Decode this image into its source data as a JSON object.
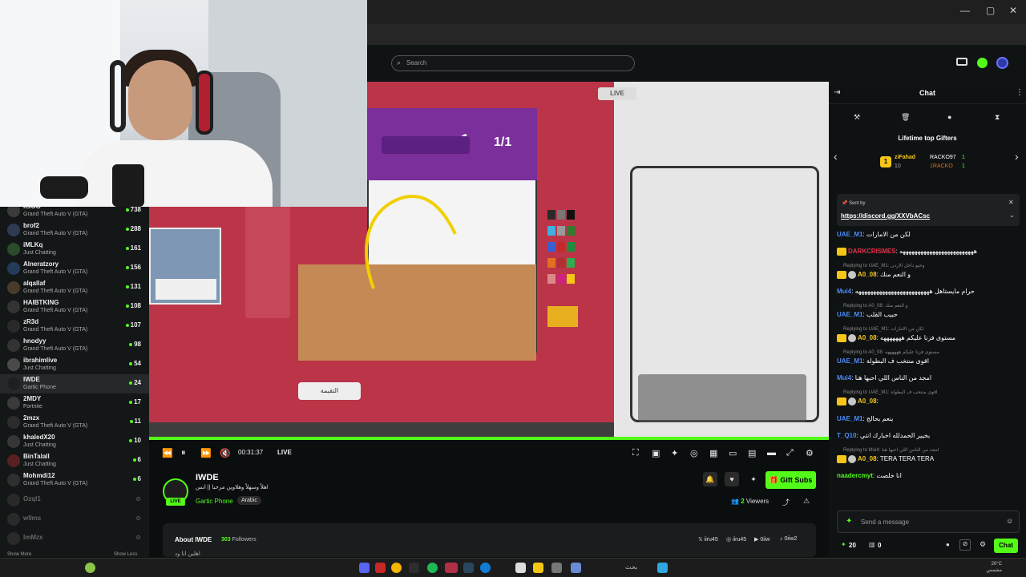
{
  "topbar": {
    "search_placeholder": "Search"
  },
  "sidebar": {
    "channels": [
      {
        "name": "itsOG",
        "game": "Grand Theft Auto V (GTA)",
        "viewers": "738"
      },
      {
        "name": "brof2",
        "game": "Grand Theft Auto V (GTA)",
        "viewers": "288"
      },
      {
        "name": "iMLKq",
        "game": "Just Chatting",
        "viewers": "161"
      },
      {
        "name": "Alneratzory",
        "game": "Grand Theft Auto V (GTA)",
        "viewers": "156"
      },
      {
        "name": "alqallaf",
        "game": "Grand Theft Auto V (GTA)",
        "viewers": "131"
      },
      {
        "name": "HAIBTKING",
        "game": "Grand Theft Auto V (GTA)",
        "viewers": "108"
      },
      {
        "name": "zR3d",
        "game": "Grand Theft Auto V (GTA)",
        "viewers": "107"
      },
      {
        "name": "hnodyy",
        "game": "Grand Theft Auto V (GTA)",
        "viewers": "98"
      },
      {
        "name": "ibrahimlive",
        "game": "Just Chatting",
        "viewers": "54"
      },
      {
        "name": "IWDE",
        "game": "Gartic Phone",
        "viewers": "24"
      },
      {
        "name": "2MDY",
        "game": "Fortnite",
        "viewers": "17"
      },
      {
        "name": "2mzx",
        "game": "Grand Theft Auto V (GTA)",
        "viewers": "11"
      },
      {
        "name": "khaledX20",
        "game": "Just Chatting",
        "viewers": "10"
      },
      {
        "name": "BinTalall",
        "game": "Just Chatting",
        "viewers": "6"
      },
      {
        "name": "Mohmdi12",
        "game": "Grand Theft Auto V (GTA)",
        "viewers": "6"
      }
    ],
    "offline": [
      "Ozql1",
      "w9ms",
      "ImMzx"
    ],
    "show_more": "Show More",
    "show_less": "Show Less"
  },
  "video": {
    "live_tag": "LIVE",
    "score": "1/1",
    "game_button": "التقيمة",
    "time": "00:31:37",
    "live_label": "LIVE"
  },
  "stream": {
    "name": "IWDE",
    "title": "اهلاً وسهلاً وهلاوين مرحبا || انس",
    "game": "Gartic Phone",
    "language": "Arabic",
    "live_badge": "LIVE",
    "viewers": "2",
    "viewers_label": "Viewers",
    "gift_subs": "Gift Subs"
  },
  "about": {
    "title": "About IWDE",
    "followers_count": "303",
    "followers_label": "Followers",
    "bio": "اهلين انا ود",
    "socials": [
      "iiru45",
      "iiru45",
      "0iiw",
      "0iiw2"
    ]
  },
  "chat": {
    "title": "Chat",
    "gifters_title": "Lifetime top Gifters",
    "gifters": [
      {
        "name": "ziFahad",
        "amount": "10"
      },
      {
        "name": "RACKO97",
        "amount": "1"
      },
      {
        "name": "1RACKO",
        "amount": "1"
      }
    ],
    "pinned_by": "Sent by",
    "pinned_link": "https://discord.gg/XXVbACsc",
    "messages": [
      {
        "user": "UAE_M1",
        "text": "لكن من الامارات",
        "color": "#4d8cf5",
        "reply": ""
      },
      {
        "user": "DARKCRISMES",
        "text": "هههههههههههههههههههههههههه",
        "color": "#e1324a",
        "reply": ""
      },
      {
        "user": "A0_08",
        "text": "و النعم منك",
        "color": "#f5c518",
        "reply": "Replying to UAE_M1: وحيو داخل الاردن"
      },
      {
        "user": "Mui4",
        "text": "حرام مايستاهل هههههههههههههههههههههههههه",
        "color": "#4d8cf5",
        "reply": ""
      },
      {
        "user": "UAE_M1",
        "text": "حبيب القلب",
        "color": "#4d8cf5",
        "reply": "Replying to A0_08: و النعم منك"
      },
      {
        "user": "A0_08",
        "text": "مستوى فزنا عليكم هههههههه",
        "color": "#f5c518",
        "reply": "Replying to UAE_M1: لكن من الامارات"
      },
      {
        "user": "UAE_M1",
        "text": "اقوى منتخب ف البطولة",
        "color": "#4d8cf5",
        "reply": "Replying to A0_08: مستوى فزنا عليكم ههههههه"
      },
      {
        "user": "Mui4",
        "text": "امجد من الناس اللي احبها هنا",
        "color": "#4d8cf5",
        "reply": ""
      },
      {
        "user": "A0_08",
        "text": "",
        "color": "#f5c518",
        "reply": "Replying to UAE_M1: اقوى منتخب ف البطولة"
      },
      {
        "user": "UAE_M1",
        "text": "ينعم بحالج",
        "color": "#4d8cf5",
        "reply": ""
      },
      {
        "user": "T_Q10",
        "text": "بخيير الحمدلله اخبارك انتي",
        "color": "#4d8cf5",
        "reply": ""
      },
      {
        "user": "A0_08",
        "text": "TERA TERA TERA",
        "color": "#f5c518",
        "reply": "Replying to Mui4: امجد من الناس اللي احبها هنا"
      },
      {
        "user": "naadercmyt",
        "text": "انا خلصت",
        "color": "#53fc18",
        "reply": ""
      }
    ],
    "send_placeholder": "Send a message",
    "points": "20",
    "count2": "0",
    "chat_button": "Chat"
  },
  "taskbar": {
    "search": "بحث",
    "temp": "20°C",
    "weather": "مشمس"
  }
}
